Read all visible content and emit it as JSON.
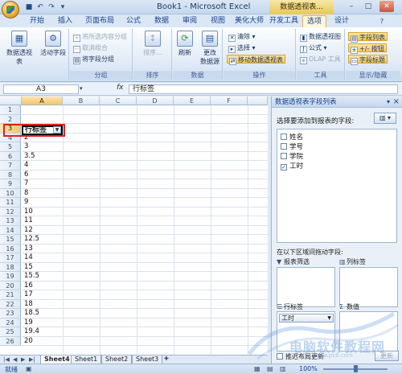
{
  "window": {
    "title": "Book1 - Microsoft Excel",
    "context_title": "数据透视表..."
  },
  "tabs": [
    "开始",
    "插入",
    "页面布局",
    "公式",
    "数据",
    "审阅",
    "视图",
    "美化大师",
    "开发工具",
    "选项",
    "设计"
  ],
  "active_tab": "选项",
  "ribbon": {
    "groups": {
      "pivot": {
        "btn1": "数据透视表",
        "btn2": "活动字段"
      },
      "group": {
        "label": "分组",
        "items": [
          "将所选内容分组",
          "取消组合",
          "将字段分组"
        ]
      },
      "sort": {
        "label": "排序",
        "btn": "排序..."
      },
      "data": {
        "label": "数据",
        "btn1": "刷新",
        "btn2": "更改",
        "btn2b": "数据源"
      },
      "actions": {
        "label": "操作",
        "items": [
          "清除",
          "选择",
          "移动数据透视表"
        ]
      },
      "tools": {
        "label": "工具",
        "items": [
          "数据透视图",
          "公式",
          "OLAP 工具"
        ]
      },
      "show": {
        "label": "显示/隐藏",
        "items": [
          "字段列表",
          "+/- 按钮",
          "字段标题"
        ]
      }
    }
  },
  "formula_bar": {
    "name_box": "A3",
    "fx": "fx",
    "content": "行标签"
  },
  "grid": {
    "columns": [
      "A",
      "B",
      "C",
      "D",
      "E",
      "F"
    ],
    "rows": [
      {
        "n": "1",
        "a": ""
      },
      {
        "n": "2",
        "a": ""
      },
      {
        "n": "3",
        "a": "行标签"
      },
      {
        "n": "4",
        "a": "2"
      },
      {
        "n": "5",
        "a": "3"
      },
      {
        "n": "6",
        "a": "3.5"
      },
      {
        "n": "7",
        "a": "4"
      },
      {
        "n": "8",
        "a": "6"
      },
      {
        "n": "9",
        "a": "7"
      },
      {
        "n": "10",
        "a": "8"
      },
      {
        "n": "11",
        "a": "9"
      },
      {
        "n": "12",
        "a": "10"
      },
      {
        "n": "13",
        "a": "11"
      },
      {
        "n": "14",
        "a": "12"
      },
      {
        "n": "15",
        "a": "12.5"
      },
      {
        "n": "16",
        "a": "13"
      },
      {
        "n": "17",
        "a": "14"
      },
      {
        "n": "18",
        "a": "15"
      },
      {
        "n": "19",
        "a": "15.5"
      },
      {
        "n": "20",
        "a": "16"
      },
      {
        "n": "21",
        "a": "17"
      },
      {
        "n": "22",
        "a": "18"
      },
      {
        "n": "23",
        "a": "18.5"
      },
      {
        "n": "24",
        "a": "19"
      },
      {
        "n": "25",
        "a": "19.4"
      },
      {
        "n": "26",
        "a": "20"
      }
    ]
  },
  "sheets": [
    "Sheet4",
    "Sheet1",
    "Sheet2",
    "Sheet3"
  ],
  "active_sheet": "Sheet4",
  "status": {
    "ready": "就绪",
    "zoom": "100%"
  },
  "pivot_pane": {
    "title": "数据透视表字段列表",
    "prompt": "选择要添加到报表的字段:",
    "layout_icon": "layout-icon",
    "fields": [
      {
        "label": "姓名",
        "checked": false
      },
      {
        "label": "学号",
        "checked": false
      },
      {
        "label": "学院",
        "checked": false
      },
      {
        "label": "工时",
        "checked": true
      }
    ],
    "areas_prompt": "在以下区域间拖动字段:",
    "areas": {
      "filter": "报表筛选",
      "columns": "列标签",
      "rows": "行标签",
      "values": "数值"
    },
    "row_item": "工时",
    "defer": "推迟布局更新",
    "update": "更新"
  },
  "watermark": {
    "text": "电脑软件教程网",
    "url": "www.pc6.com"
  },
  "colors": {
    "accent": "#15428b",
    "highlight": "#e02020"
  }
}
